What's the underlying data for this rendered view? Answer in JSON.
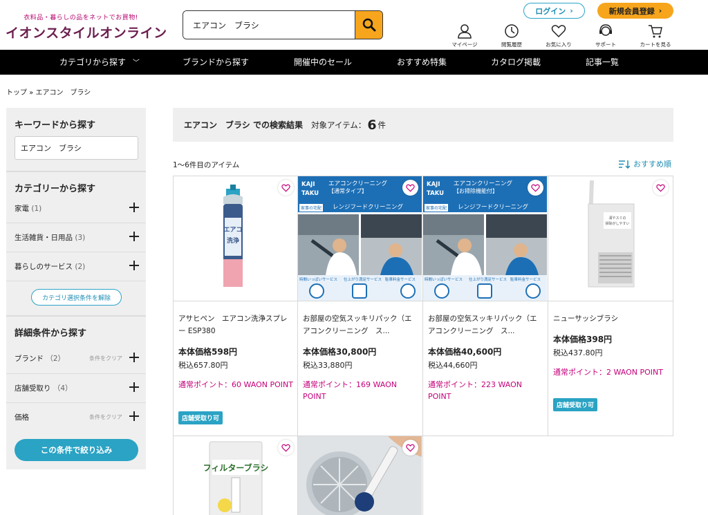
{
  "header": {
    "logo_tagline": "衣料品・暮らしの品をネットでお買物!",
    "logo_name": "イオンスタイルオンライン",
    "search_value": "エアコン　ブラシ",
    "login_label": "ログイン",
    "register_label": "新規会員登録",
    "icons": [
      {
        "name": "mypage",
        "label": "マイページ"
      },
      {
        "name": "history",
        "label": "閲覧履歴"
      },
      {
        "name": "favorites",
        "label": "お気に入り"
      },
      {
        "name": "support",
        "label": "サポート"
      },
      {
        "name": "cart",
        "label": "カートを見る"
      }
    ]
  },
  "nav": [
    "カテゴリから探す",
    "ブランドから探す",
    "開催中のセール",
    "おすすめ特集",
    "カタログ掲載",
    "記事一覧"
  ],
  "breadcrumb": "トップ » エアコン　ブラシ",
  "sidebar": {
    "keyword_title": "キーワードから探す",
    "keyword_value": "エアコン　ブラシ",
    "category_title": "カテゴリーから探す",
    "categories": [
      {
        "label": "家電",
        "count": "(1)"
      },
      {
        "label": "生活雑貨・日用品",
        "count": "(3)"
      },
      {
        "label": "暮らしのサービス",
        "count": "(2)"
      }
    ],
    "clear_category": "カテゴリ選択条件を解除",
    "detail_title": "詳細条件から探す",
    "details": [
      {
        "label": "ブランド",
        "count": "（2）",
        "clear": "条件をクリア"
      },
      {
        "label": "店舗受取り",
        "count": "（4）",
        "clear": ""
      },
      {
        "label": "価格",
        "count": "",
        "clear": "条件をクリア"
      }
    ],
    "apply_label": "この条件で絞り込み"
  },
  "results": {
    "query_text": "エアコン　ブラシ での検索結果",
    "target_label": "対象アイテム：",
    "count": "6",
    "unit": "件",
    "range_text": "1〜6件目のアイテム",
    "sort_label": "おすすめ順"
  },
  "banner": {
    "logo": "KAJI TAKU",
    "logo_sub": "家事の宅配",
    "footer_labels": [
      "時間いっぱいサービス",
      "仕上がり満足サービス",
      "駐車料金サービス"
    ]
  },
  "products": [
    {
      "name": "アサヒペン　エアコン洗浄スプレー ESP380",
      "price": "本体価格598円",
      "tax": "税込657.80円",
      "point": "通常ポイント：60 WAON POINT",
      "pickup": "店舗受取り可"
    },
    {
      "name": "お部屋の空気スッキリパック（エアコンクリーニング　ス...",
      "price": "本体価格30,800円",
      "tax": "税込33,880円",
      "point": "通常ポイント：169 WAON POINT",
      "pickup": "",
      "banner_title": "エアコンクリーニング",
      "banner_sub": "【通常タイプ】",
      "banner_extra": "レンジフードクリーニング"
    },
    {
      "name": "お部屋の空気スッキリパック（エアコンクリーニング　ス...",
      "price": "本体価格40,600円",
      "tax": "税込44,660円",
      "point": "通常ポイント：223 WAON POINT",
      "pickup": "",
      "banner_title": "エアコンクリーニング",
      "banner_sub": "【お掃除機能付】",
      "banner_extra": "レンジフードクリーニング"
    },
    {
      "name": "ニューサッシブラシ",
      "price": "本体価格398円",
      "tax": "税込437.80円",
      "point": "通常ポイント：2 WAON POINT",
      "pickup": "店舗受取り可"
    },
    {
      "name": "フィルターブラシ",
      "price": "",
      "tax": "",
      "point": "",
      "pickup": "",
      "package_text": "フィルターブラシ"
    },
    {
      "name": "",
      "price": "",
      "tax": "",
      "point": "",
      "pickup": ""
    }
  ]
}
